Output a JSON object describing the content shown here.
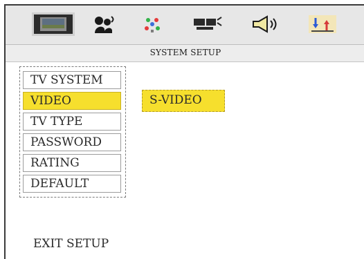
{
  "toolbar": {
    "icons": [
      {
        "name": "system-setup-icon",
        "selected": true
      },
      {
        "name": "language-icon",
        "selected": false
      },
      {
        "name": "video-icon",
        "selected": false
      },
      {
        "name": "parental-icon",
        "selected": false
      },
      {
        "name": "audio-icon",
        "selected": false
      },
      {
        "name": "misc-icon",
        "selected": false
      }
    ]
  },
  "section": {
    "title": "SYSTEM SETUP"
  },
  "menu": {
    "items": [
      {
        "label": "TV SYSTEM",
        "active": false
      },
      {
        "label": "VIDEO",
        "active": true
      },
      {
        "label": "TV TYPE",
        "active": false
      },
      {
        "label": "PASSWORD",
        "active": false
      },
      {
        "label": "RATING",
        "active": false
      },
      {
        "label": "DEFAULT",
        "active": false
      }
    ]
  },
  "submenu": {
    "value": "S-VIDEO"
  },
  "footer": {
    "exit_label": "EXIT SETUP"
  },
  "colors": {
    "highlight": "#f6df2d",
    "panel": "#e7e7e7"
  }
}
